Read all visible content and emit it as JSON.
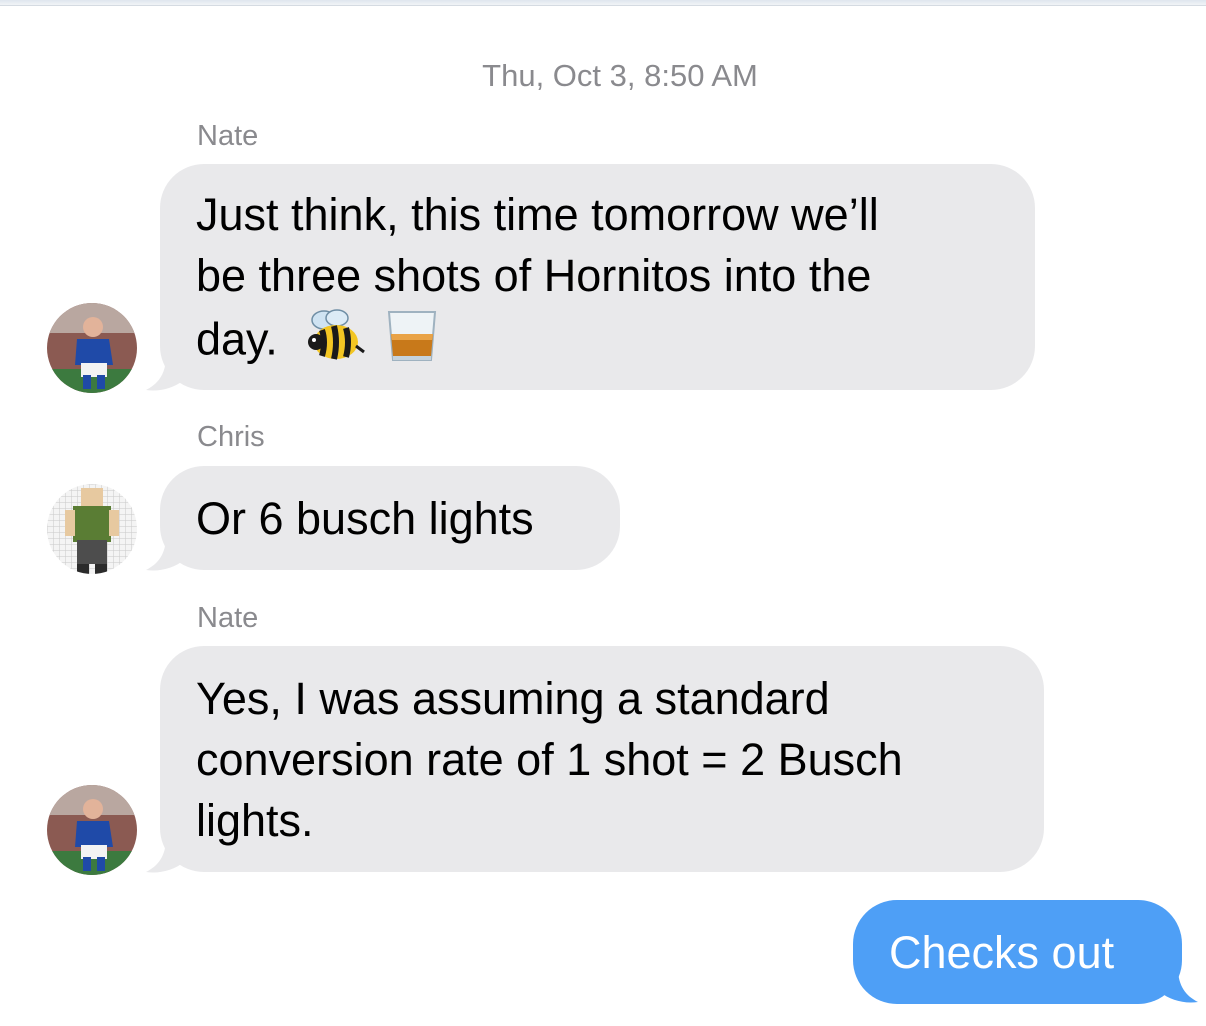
{
  "header": {
    "timestamp": "Thu, Oct 3, 8:50 AM"
  },
  "messages": [
    {
      "sender": "Nate",
      "text_line1": "Just think, this time tomorrow we’ll",
      "text_line2": "be three shots of Hornitos into the",
      "text_line3": "day.",
      "emoji": [
        "bee-icon",
        "tumbler-glass-icon"
      ]
    },
    {
      "sender": "Chris",
      "text": "Or 6 busch lights"
    },
    {
      "sender": "Nate",
      "text_line1": "Yes, I was assuming a standard",
      "text_line2": "conversion rate of 1 shot = 2 Busch",
      "text_line3": "lights."
    },
    {
      "sender": "me",
      "text": "Checks out"
    }
  ],
  "colors": {
    "incoming_bubble": "#e9e9eb",
    "outgoing_bubble": "#4e9ff6",
    "meta_text": "#8a8a8e"
  }
}
